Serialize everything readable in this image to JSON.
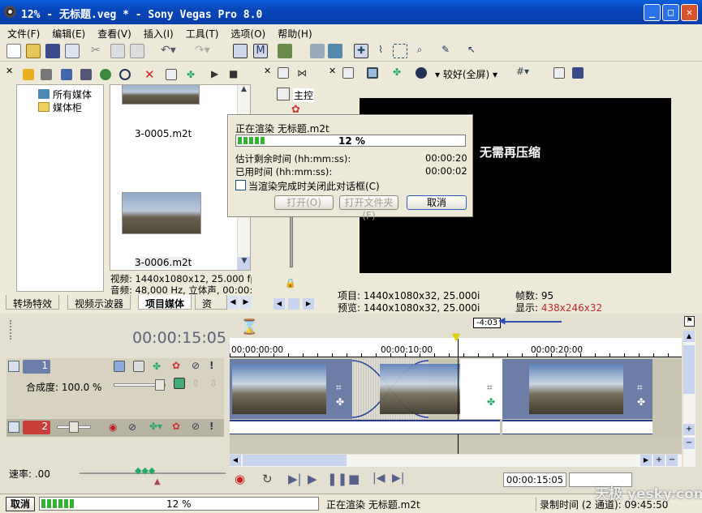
{
  "window": {
    "title": "12% - 无标题.veg * - Sony Vegas Pro 8.0"
  },
  "menu": [
    "文件(F)",
    "编辑(E)",
    "查看(V)",
    "插入(I)",
    "工具(T)",
    "选项(O)",
    "帮助(H)"
  ],
  "explorer": {
    "tree": [
      "所有媒体",
      "媒体柜"
    ],
    "files": [
      "3-0005.m2t",
      "3-0006.m2t"
    ],
    "info_video": "视频: 1440x1080x12, 25.000 fp",
    "info_audio": "音频: 48,000 Hz, 立体声, 00:00:",
    "tabs": [
      "转场特效",
      "视频示波器",
      "项目媒体",
      "资源"
    ]
  },
  "preview": {
    "quality": "较好(全屏)",
    "overlay_text": "无需再压缩",
    "project": "项目: 1440x1080x32, 25.000i",
    "preview": "预览: 1440x1080x32, 25.000i",
    "frames": "帧数: 95",
    "display_label": "显示: ",
    "display_value": "438x246x32"
  },
  "mixer": {
    "label": "主控"
  },
  "render_dialog": {
    "title": "正在渲染 无标题.m2t",
    "progress_text": "12 %",
    "progress": 0.12,
    "remaining_label": "估计剩余时间 (hh:mm:ss):",
    "remaining_value": "00:00:20",
    "elapsed_label": "已用时间 (hh:mm:ss):",
    "elapsed_value": "00:00:02",
    "checkbox_label": "当渲染完成时关闭此对话框(C)",
    "open_label": "打开(O)",
    "open_folder_label": "打开文件夹(F)",
    "cancel_label": "取消"
  },
  "timeline": {
    "timecode": "00:00:15:05",
    "marker": "-4:03",
    "ruler": [
      "00:00:00:00",
      "00:00:10:00",
      "00:00:20:00"
    ],
    "track1_number": "1",
    "track2_number": "2",
    "composite": "合成度: 100.0 %",
    "rate": "速率: .00",
    "transport_time": "00:00:15:05"
  },
  "status": {
    "cancel": "取消",
    "progress_text": "12 %",
    "progress": 0.12,
    "rendering": "正在渲染 无标题.m2t",
    "record_time": "录制时间 (2 通道): 09:45:50",
    "watermark": "天极 yesky.com"
  },
  "colors": {
    "accent": "#0a46b9",
    "progress": "#34b234",
    "display_value": "#c0282d",
    "marker_arrow": "#2e4fb4"
  }
}
